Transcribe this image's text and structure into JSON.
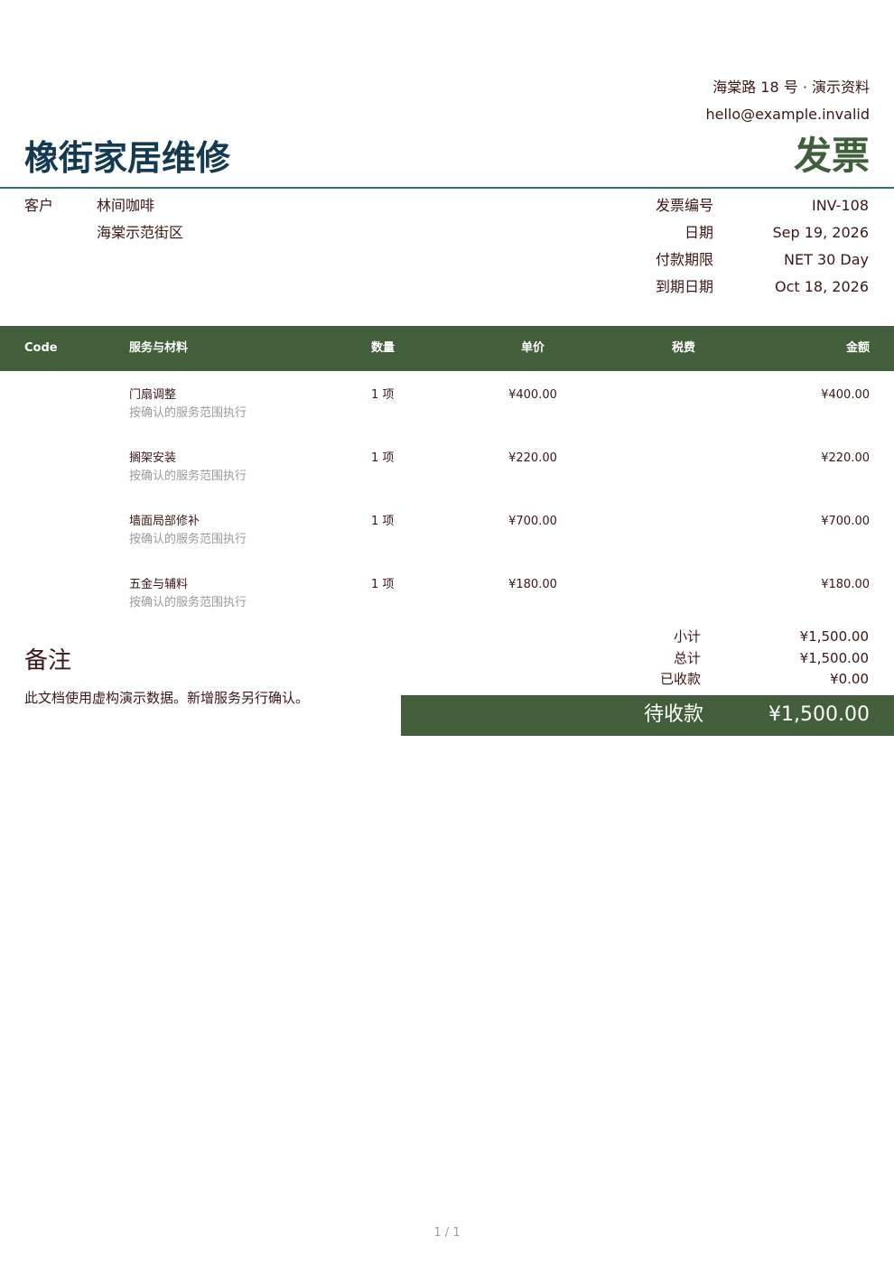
{
  "sender": {
    "address": "海棠路 18 号 · 演示资料",
    "email": "hello@example.invalid"
  },
  "company": "橡街家居维修",
  "doc_title": "发票",
  "client": {
    "label": "客户",
    "name": "林间咖啡",
    "address": "海棠示范街区"
  },
  "meta": [
    {
      "label": "发票编号",
      "value": "INV-108"
    },
    {
      "label": "日期",
      "value": "Sep 19, 2026"
    },
    {
      "label": "付款期限",
      "value": "NET 30 Day"
    },
    {
      "label": "到期日期",
      "value": "Oct 18, 2026"
    }
  ],
  "table": {
    "headers": {
      "code": "Code",
      "description": "服务与材料",
      "quantity": "数量",
      "unit_price": "单价",
      "tax": "税费",
      "amount": "金额"
    },
    "rows": [
      {
        "code": "",
        "name": "门扇调整",
        "note": "按确认的服务范围执行",
        "quantity": "1 项",
        "unit_price": "¥400.00",
        "tax": "",
        "amount": "¥400.00"
      },
      {
        "code": "",
        "name": "搁架安装",
        "note": "按确认的服务范围执行",
        "quantity": "1 项",
        "unit_price": "¥220.00",
        "tax": "",
        "amount": "¥220.00"
      },
      {
        "code": "",
        "name": "墙面局部修补",
        "note": "按确认的服务范围执行",
        "quantity": "1 项",
        "unit_price": "¥700.00",
        "tax": "",
        "amount": "¥700.00"
      },
      {
        "code": "",
        "name": "五金与辅料",
        "note": "按确认的服务范围执行",
        "quantity": "1 项",
        "unit_price": "¥180.00",
        "tax": "",
        "amount": "¥180.00"
      }
    ]
  },
  "notes": {
    "title": "备注",
    "text": "此文档使用虚构演示数据。新增服务另行确认。"
  },
  "totals": [
    {
      "label": "小计",
      "value": "¥1,500.00"
    },
    {
      "label": "总计",
      "value": "¥1,500.00"
    },
    {
      "label": "已收款",
      "value": "¥0.00"
    }
  ],
  "balance_due": {
    "label": "待收款",
    "value": "¥1,500.00"
  },
  "page_indicator": "1 / 1",
  "colors": {
    "brand": "#143a52",
    "accent": "#425e3a",
    "text": "#3b1717",
    "rule": "#2f6e7c"
  }
}
